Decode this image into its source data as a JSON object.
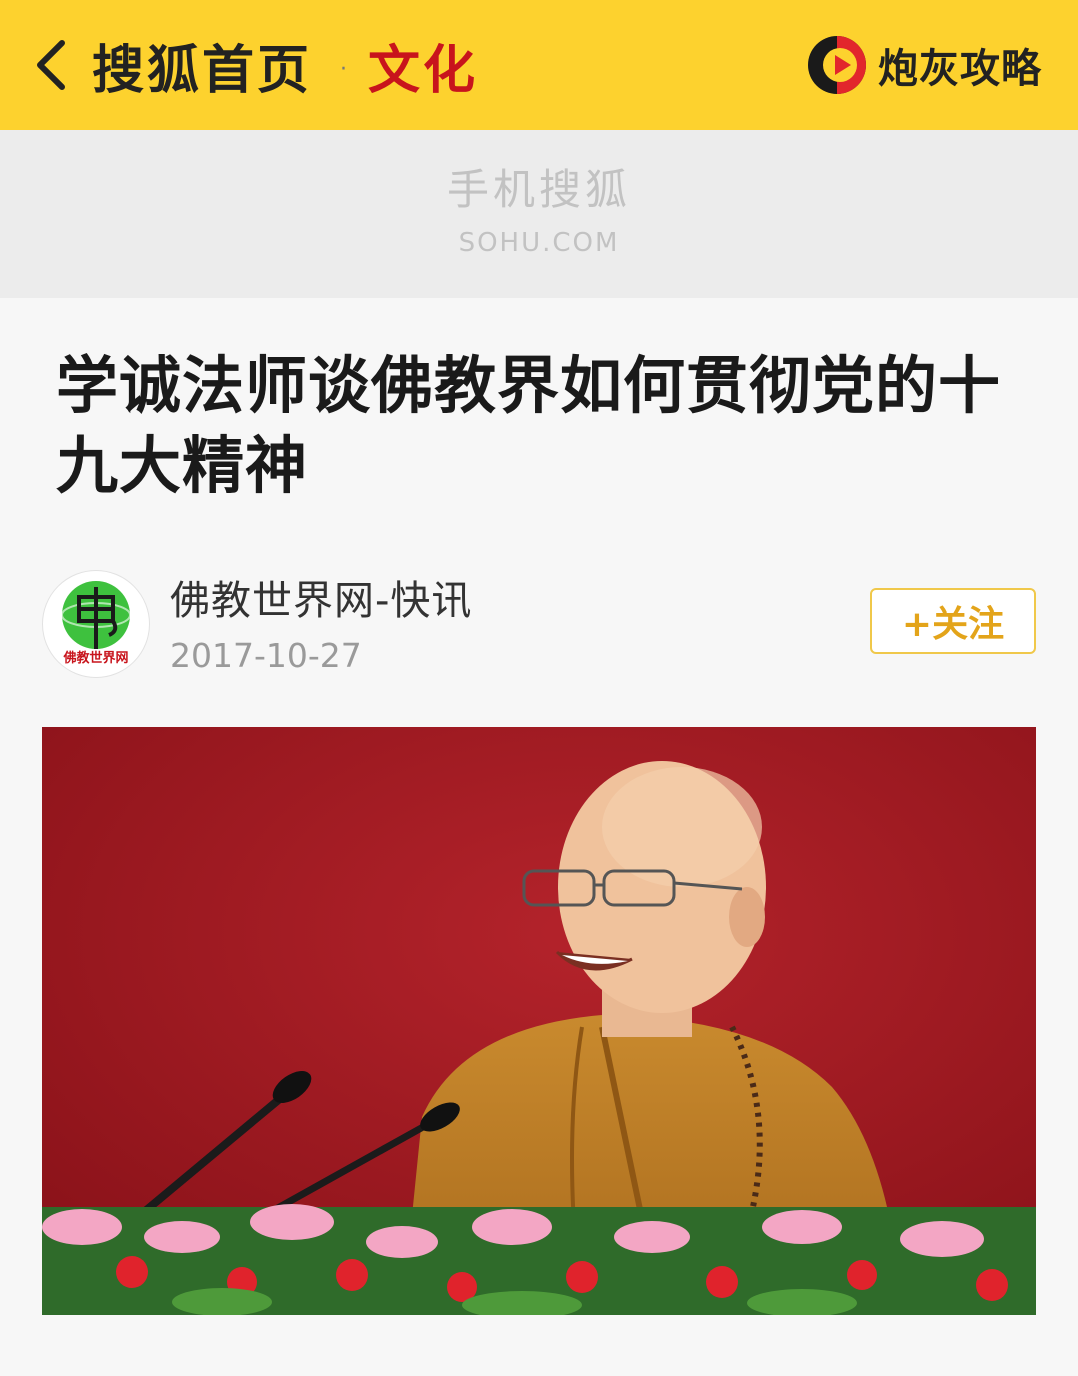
{
  "topbar": {
    "back_icon": "chevron-left-icon",
    "brand": "搜狐首页",
    "separator": "·",
    "channel": "文化",
    "promo_icon": "play-circle-icon",
    "promo_label": "炮灰攻略",
    "colors": {
      "bar": "#fdd22e",
      "channel": "#c8141c"
    }
  },
  "banner": {
    "cn": "手机搜狐",
    "en": "SOHU.COM"
  },
  "article": {
    "title": "学诚法师谈佛教界如何贯彻党的十九大精神",
    "author": {
      "avatar_text": "佛教世界网",
      "name": "佛教世界网-快讯",
      "date": "2017-10-27"
    },
    "follow_label": "+关注",
    "photo_description_icon": "article-photo"
  }
}
